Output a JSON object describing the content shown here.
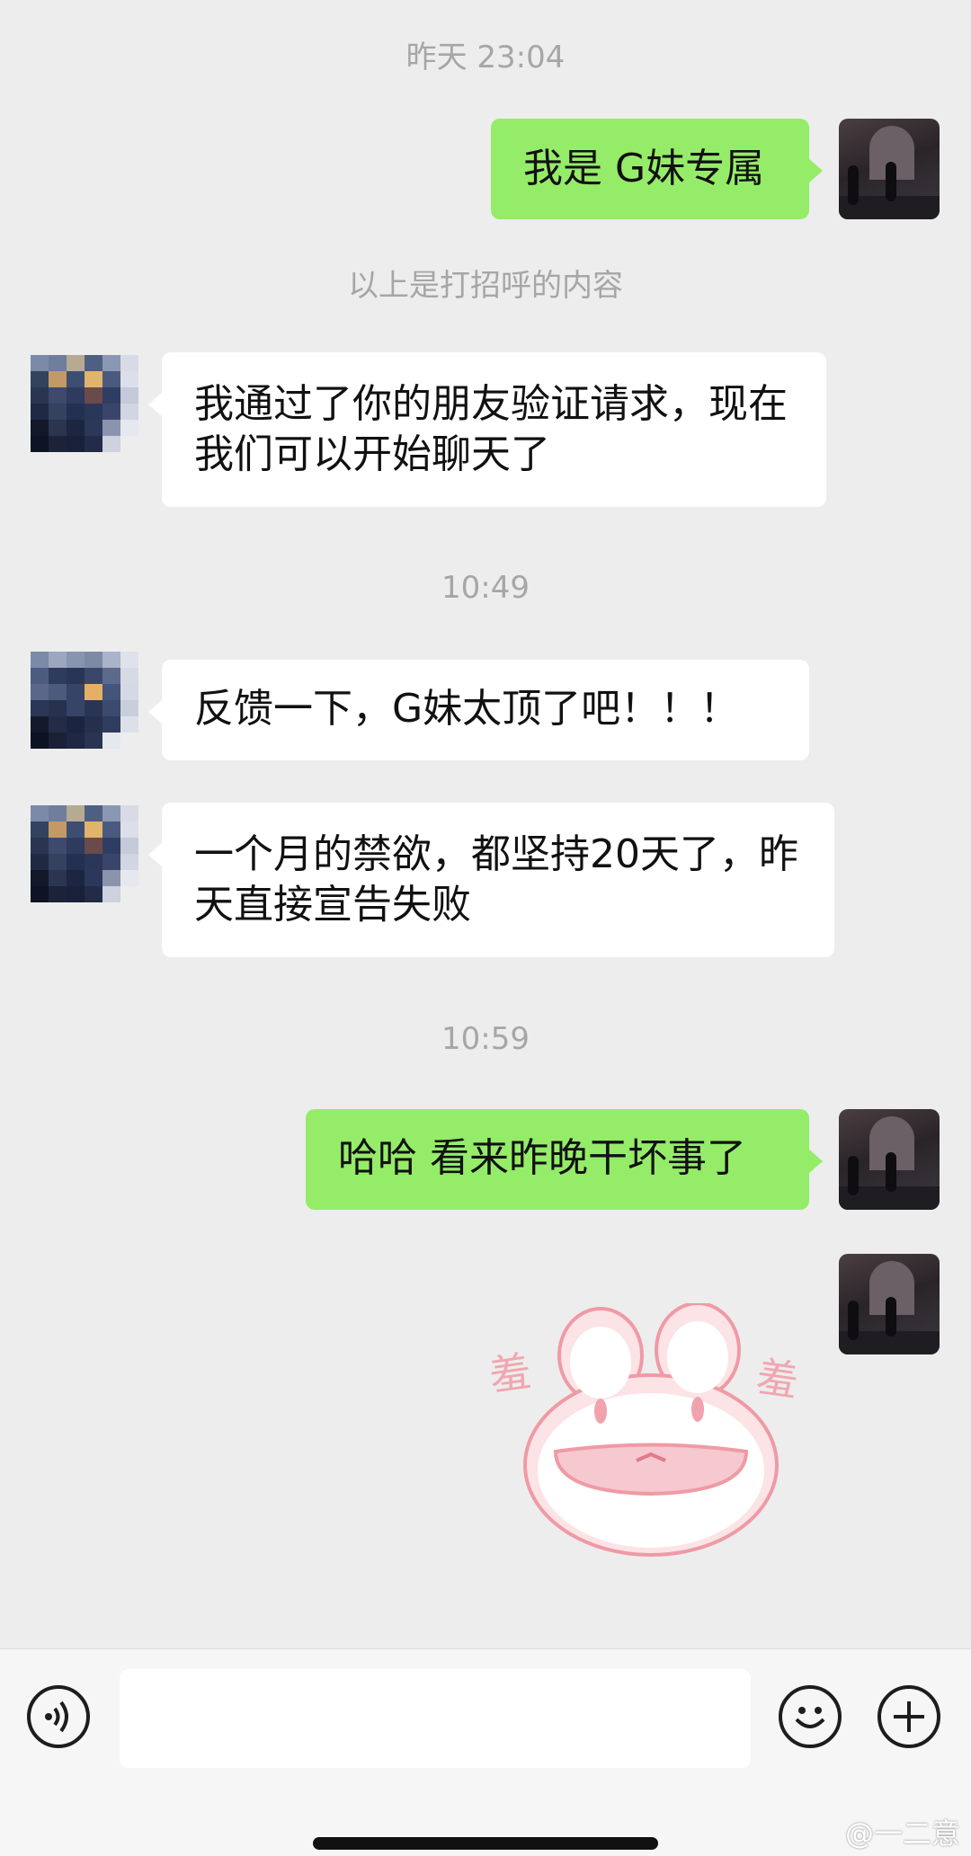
{
  "chat": {
    "timestamp_1": "昨天 23:04",
    "greeting_message": "我是 G妹专属",
    "system_notice": "以上是打招呼的内容",
    "friend_accept_message": "我通过了你的朋友验证请求，现在我们可以开始聊天了",
    "timestamp_2": "10:49",
    "feedback_message_1": "反馈一下，G妹太顶了吧！！！",
    "feedback_message_2": "一个月的禁欲，都坚持20天了，昨天直接宣告失败",
    "timestamp_3": "10:59",
    "reply_message": "哈哈 看来昨晚干坏事了",
    "sticker_text_left": "羞",
    "sticker_text_right": "羞"
  },
  "composer": {
    "input_value": "",
    "voice_icon": "voice-icon",
    "emoji_icon": "emoji-icon",
    "add_icon": "plus-icon"
  },
  "watermark": "@一二意",
  "colors": {
    "background": "#ededed",
    "outgoing_bubble": "#95ec69",
    "incoming_bubble": "#ffffff",
    "timestamp_text": "#a6a6a6"
  }
}
